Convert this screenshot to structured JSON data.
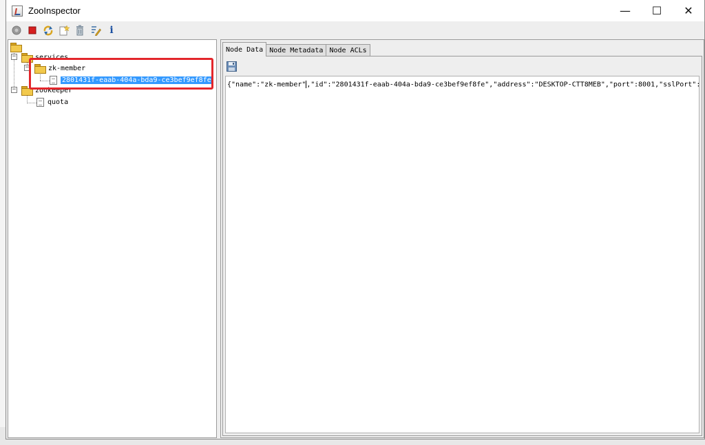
{
  "window": {
    "title": "ZooInspector",
    "controls": {
      "minimize": "—",
      "maximize": "☐",
      "close": "✕"
    }
  },
  "toolbar": {
    "buttons": [
      {
        "name": "connect-icon",
        "color": "#9a9a9a"
      },
      {
        "name": "disconnect-icon",
        "color": "#d62020"
      },
      {
        "name": "refresh-icon",
        "color": "#d9a520"
      },
      {
        "name": "add-node-icon",
        "color": "#d9a520"
      },
      {
        "name": "delete-node-icon",
        "color": "#8a9aa8"
      },
      {
        "name": "edit-icon",
        "color": "#3a6ea5"
      },
      {
        "name": "info-icon",
        "color": "#1a4fa0"
      }
    ],
    "info_glyph": "i"
  },
  "tree": {
    "root_label": "",
    "nodes": [
      {
        "label": "services",
        "type": "folder",
        "expanded": true
      },
      {
        "label": "zk-member",
        "type": "folder",
        "expanded": true
      },
      {
        "label": "2801431f-eaab-404a-bda9-ce3bef9ef8fe",
        "type": "leaf",
        "selected": true
      },
      {
        "label": "zookeeper",
        "type": "folder",
        "expanded": true
      },
      {
        "label": "quota",
        "type": "leaf",
        "selected": false
      }
    ],
    "highlight_color": "#e3262b",
    "selection_color": "#3399ff"
  },
  "tabs": [
    {
      "label": "Node Data",
      "active": true
    },
    {
      "label": "Node Metadata",
      "active": false
    },
    {
      "label": "Node ACLs",
      "active": false
    }
  ],
  "node_data": {
    "text_before_caret": "{\"name\":\"zk-member\"",
    "text_after_caret": ",\"id\":\"2801431f-eaab-404a-bda9-ce3bef9ef8fe\",\"address\":\"DESKTOP-CTT8MEB\",\"port\":8001,\"sslPort\":n"
  }
}
